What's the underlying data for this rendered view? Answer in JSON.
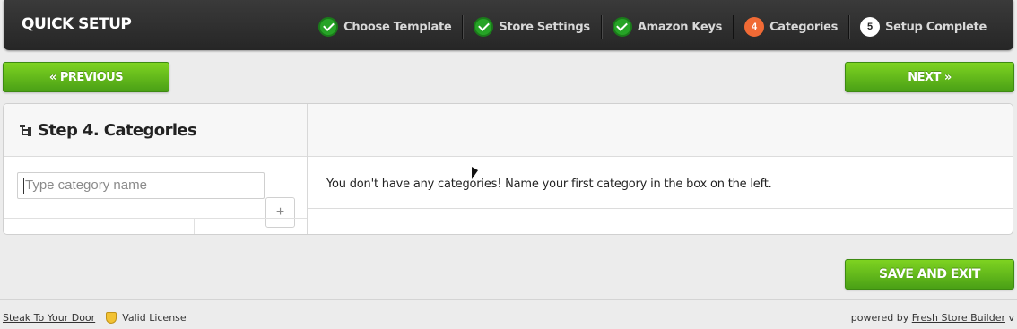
{
  "header": {
    "title": "QUICK SETUP",
    "steps": [
      {
        "label": "Choose Template",
        "state": "done"
      },
      {
        "label": "Store Settings",
        "state": "done"
      },
      {
        "label": "Amazon Keys",
        "state": "done"
      },
      {
        "label": "Categories",
        "state": "current",
        "number": "4"
      },
      {
        "label": "Setup Complete",
        "state": "pending",
        "number": "5"
      }
    ]
  },
  "nav": {
    "previous_label": "« PREVIOUS",
    "next_label": "NEXT »",
    "save_label": "SAVE AND EXIT"
  },
  "categories": {
    "heading": "Step 4. Categories",
    "input_placeholder": "Type category name",
    "add_button": "+",
    "empty_message": "You don't have any categories! Name your first category in the box on the left."
  },
  "footer": {
    "store_link": "Steak To Your Door",
    "license": "Valid License",
    "powered_prefix": "powered by",
    "powered_link": "Fresh Store Builder",
    "powered_suffix": "v"
  },
  "colors": {
    "accent_green": "#5cb81c",
    "step_current": "#f06a35",
    "step_done": "#26a326",
    "topbar": "#2b2b2b"
  }
}
